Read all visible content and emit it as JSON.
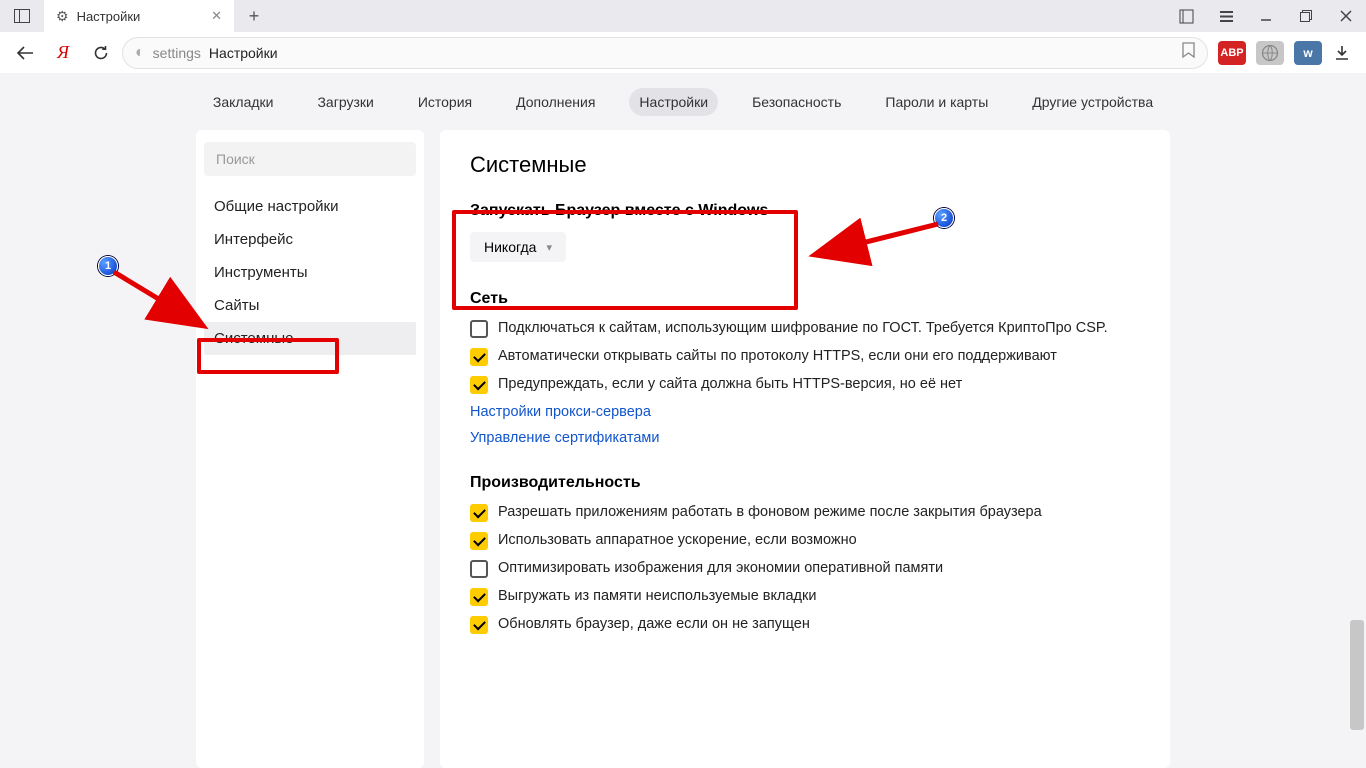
{
  "window": {
    "tab_title": "Настройки"
  },
  "smartbox": {
    "prefix": "settings",
    "page": "Настройки"
  },
  "topnav": {
    "items": [
      "Закладки",
      "Загрузки",
      "История",
      "Дополнения",
      "Настройки",
      "Безопасность",
      "Пароли и карты",
      "Другие устройства"
    ],
    "active_index": 4
  },
  "sidebar": {
    "search_placeholder": "Поиск",
    "items": [
      "Общие настройки",
      "Интерфейс",
      "Инструменты",
      "Сайты",
      "Системные"
    ],
    "active_index": 4
  },
  "content": {
    "title": "Системные",
    "launch": {
      "heading": "Запускать Браузер вместе с Windows",
      "dropdown_value": "Никогда"
    },
    "network": {
      "heading": "Сеть",
      "items": [
        {
          "checked": false,
          "label": "Подключаться к сайтам, использующим шифрование по ГОСТ. Требуется КриптоПро CSP."
        },
        {
          "checked": true,
          "label": "Автоматически открывать сайты по протоколу HTTPS, если они его поддерживают"
        },
        {
          "checked": true,
          "label": "Предупреждать, если у сайта должна быть HTTPS-версия, но её нет"
        }
      ],
      "links": [
        "Настройки прокси-сервера",
        "Управление сертификатами"
      ]
    },
    "performance": {
      "heading": "Производительность",
      "items": [
        {
          "checked": true,
          "label": "Разрешать приложениям работать в фоновом режиме после закрытия браузера"
        },
        {
          "checked": true,
          "label": "Использовать аппаратное ускорение, если возможно"
        },
        {
          "checked": false,
          "label": "Оптимизировать изображения для экономии оперативной памяти"
        },
        {
          "checked": true,
          "label": "Выгружать из памяти неиспользуемые вкладки"
        },
        {
          "checked": true,
          "label": "Обновлять браузер, даже если он не запущен"
        }
      ]
    }
  },
  "ext": {
    "abp": "ABP",
    "vk": "w"
  },
  "annotations": {
    "badge1": "1",
    "badge2": "2"
  }
}
